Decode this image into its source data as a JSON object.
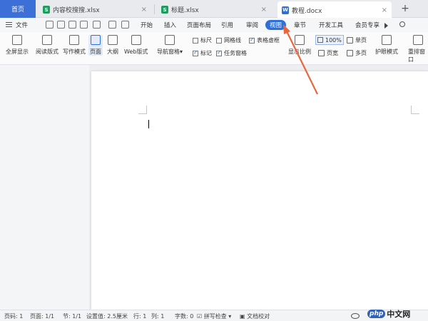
{
  "tabs": [
    {
      "label": "首页"
    },
    {
      "label": "内容校搜搜.xlsx",
      "type": "xlsx"
    },
    {
      "label": "标题.xlsx",
      "type": "xlsx"
    },
    {
      "label": "教程.docx",
      "type": "docx"
    }
  ],
  "tab_close": "×",
  "new_tab": "+",
  "menu": {
    "file": "文件",
    "items": [
      "开始",
      "插入",
      "页面布局",
      "引用",
      "审阅",
      "视图",
      "章节",
      "开发工具",
      "会员专享"
    ],
    "active": "视图"
  },
  "ribbon": {
    "buttons": [
      "全屏显示",
      "阅读版式",
      "写作模式",
      "页面",
      "大纲",
      "Web版式",
      "导航窗格"
    ],
    "dropdown": "▾",
    "checks": [
      {
        "label": "标尺",
        "checked": false
      },
      {
        "label": "网格线",
        "checked": false
      },
      {
        "label": "表格虚框",
        "checked": true
      },
      {
        "label": "标记",
        "checked": true
      },
      {
        "label": "任务窗格",
        "checked": true
      }
    ],
    "zoom": "100%",
    "zoom_ratio": "显示比例",
    "single": "单页",
    "page": "页宽",
    "multi": "多页",
    "eye_mode": "护眼模式",
    "rearrange": "重排窗口"
  },
  "status": {
    "page_no": "页码: 1",
    "pages": "页面: 1/1",
    "section": "节: 1/1",
    "setting": "设置值: 2.5厘米",
    "row": "行: 1",
    "col": "列: 1",
    "words": "字数: 0",
    "spell": "拼写检查",
    "proof": "文档校对"
  },
  "watermark": {
    "badge": "php",
    "text": "中文网"
  },
  "colors": {
    "accent": "#2f6fd6",
    "home_tab": "#3c6fd8",
    "arrow": "#e8663d"
  }
}
